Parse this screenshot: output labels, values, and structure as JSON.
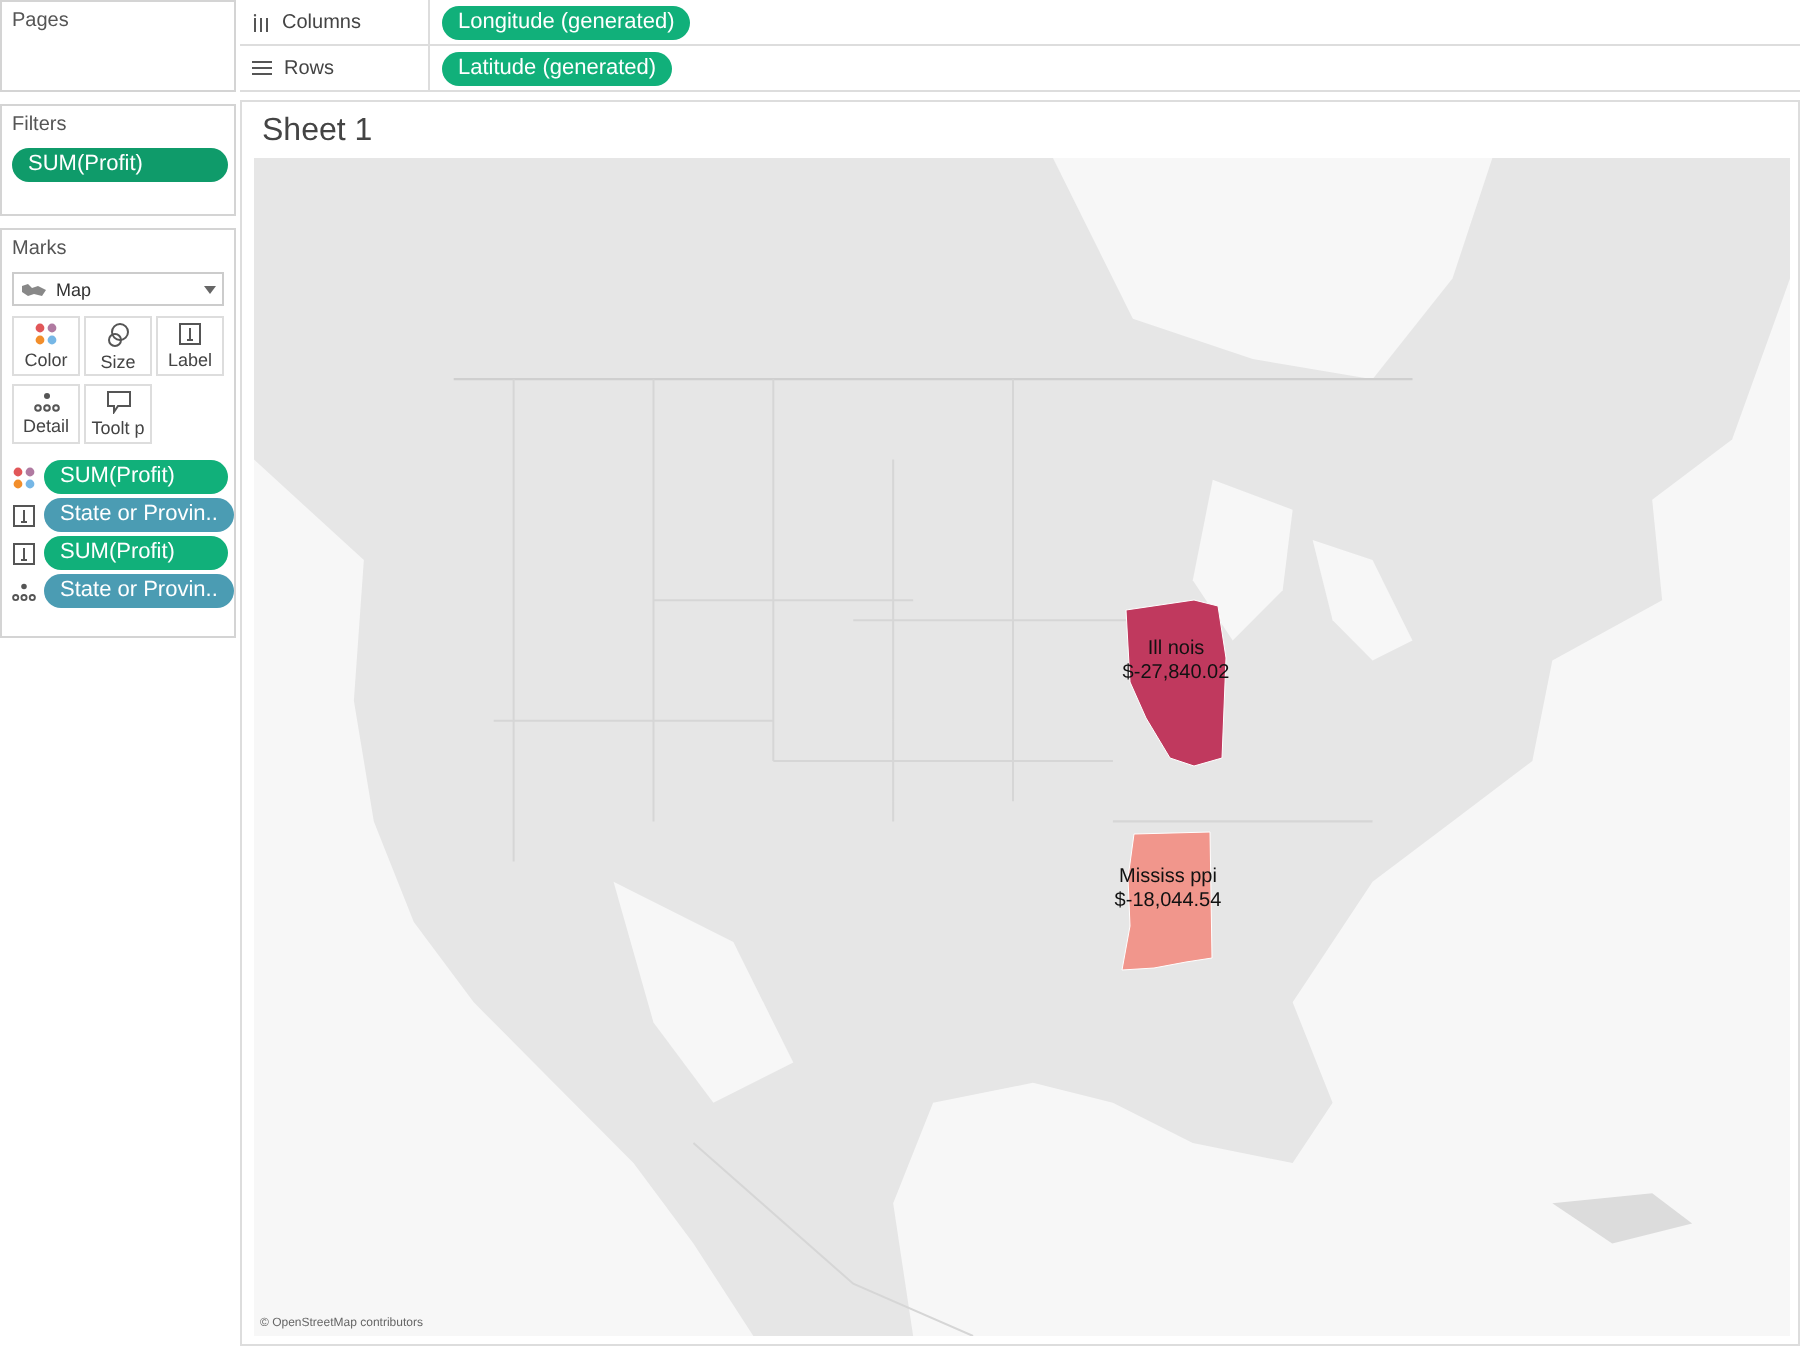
{
  "pages": {
    "title": "Pages"
  },
  "filters": {
    "title": "Filters",
    "pills": [
      {
        "text": "SUM(Profit)",
        "color": "#0f9b6a"
      }
    ]
  },
  "marks": {
    "title": "Marks",
    "mark_type": "Map",
    "buttons": [
      {
        "kind": "color",
        "label": "Color"
      },
      {
        "kind": "size",
        "label": "Size"
      },
      {
        "kind": "label",
        "label": "Label"
      },
      {
        "kind": "detail",
        "label": "Detail"
      },
      {
        "kind": "tooltip",
        "label": "Toolt p"
      }
    ],
    "fields": [
      {
        "kind": "color",
        "text": "SUM(Profit)",
        "color": "#11b07a"
      },
      {
        "kind": "label",
        "text": "State or Provin..",
        "color": "#4b9cb3"
      },
      {
        "kind": "label",
        "text": "SUM(Profit)",
        "color": "#11b07a"
      },
      {
        "kind": "detail",
        "text": "State or Provin..",
        "color": "#4b9cb3"
      }
    ]
  },
  "shelves": [
    {
      "kind": "columns",
      "label": "Columns",
      "pill": {
        "text": "Longitude (generated)",
        "color": "#11b07a"
      }
    },
    {
      "kind": "rows",
      "label": "Rows",
      "pill": {
        "text": "Latitude (generated)",
        "color": "#11b07a"
      }
    }
  ],
  "sheet": {
    "title": "Sheet 1",
    "map": {
      "kind": "picture",
      "attribution": "© OpenStreetMap contributors",
      "states": [
        {
          "name": "Ill nois",
          "value": "$-27,840.02",
          "color": "#c0395e"
        },
        {
          "name": "Mississ ppi",
          "value": "$-18,044.54",
          "color": "#f1968c"
        }
      ]
    }
  }
}
